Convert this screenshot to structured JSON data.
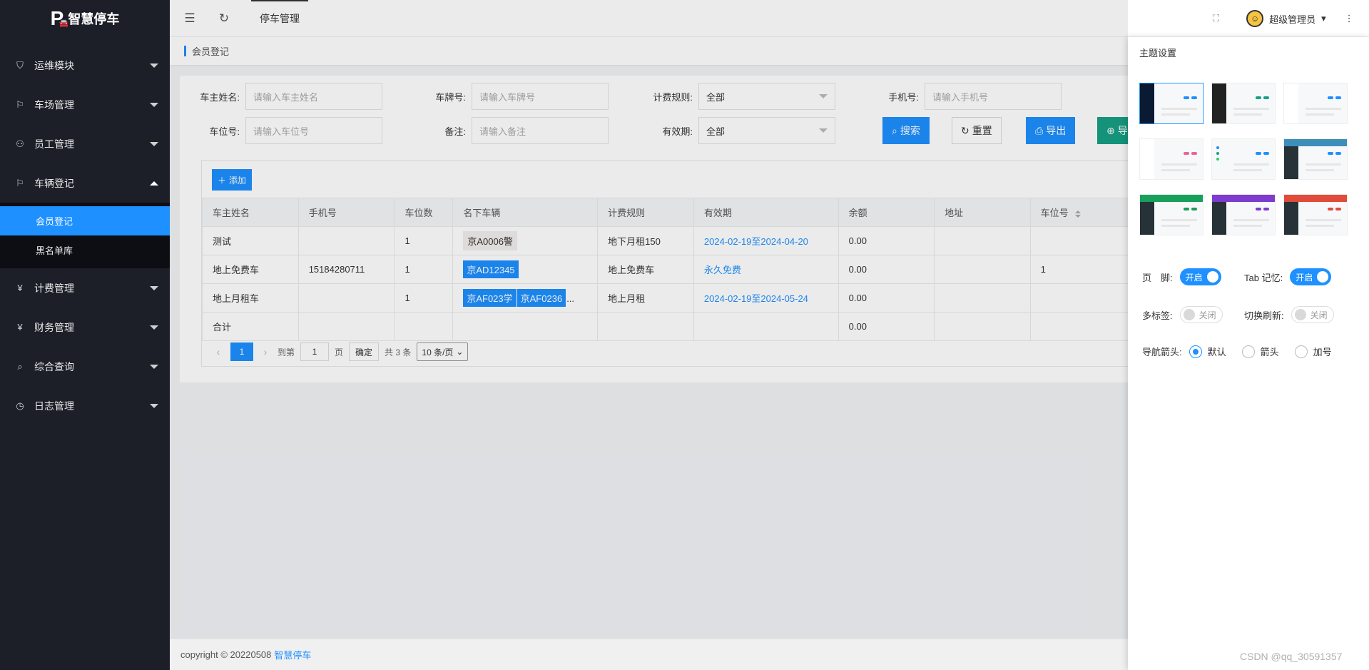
{
  "app": {
    "name": "智慧停车"
  },
  "sidebar": {
    "items": [
      {
        "label": "运维模块",
        "icon": "shield-icon"
      },
      {
        "label": "车场管理",
        "icon": "flag-icon"
      },
      {
        "label": "员工管理",
        "icon": "user-icon"
      },
      {
        "label": "车辆登记",
        "icon": "flag-icon"
      },
      {
        "label": "计费管理",
        "icon": "yen-icon"
      },
      {
        "label": "财务管理",
        "icon": "yen-icon"
      },
      {
        "label": "综合查询",
        "icon": "search-icon"
      },
      {
        "label": "日志管理",
        "icon": "clock-icon"
      }
    ],
    "submenu": [
      "会员登记",
      "黑名单库"
    ]
  },
  "header": {
    "tab": "停车管理",
    "user": "超级管理员"
  },
  "breadcrumb": "会员登记",
  "filters": {
    "owner_name": {
      "label": "车主姓名:",
      "placeholder": "请输入车主姓名"
    },
    "plate": {
      "label": "车牌号:",
      "placeholder": "请输入车牌号"
    },
    "billing_rule": {
      "label": "计费规则:",
      "value": "全部"
    },
    "phone": {
      "label": "手机号:",
      "placeholder": "请输入手机号"
    },
    "space_no": {
      "label": "车位号:",
      "placeholder": "请输入车位号"
    },
    "remark": {
      "label": "备注:",
      "placeholder": "请输入备注"
    },
    "validity": {
      "label": "有效期:",
      "value": "全部"
    }
  },
  "buttons": {
    "search": "搜索",
    "reset": "重置",
    "export": "导出",
    "import_partial": "导",
    "add": "添加"
  },
  "table": {
    "columns": [
      "车主姓名",
      "手机号",
      "车位数",
      "名下车辆",
      "计费规则",
      "有效期",
      "余额",
      "地址",
      "车位号"
    ],
    "rows": [
      {
        "name": "测试",
        "phone": "",
        "count": "1",
        "plates": [
          "京A0006警"
        ],
        "rule": "地下月租150",
        "validity": "2024-02-19至2024-04-20",
        "balance": "0.00",
        "address": "",
        "space": ""
      },
      {
        "name": "地上免费车",
        "phone": "15184280711",
        "count": "1",
        "plates": [
          "京AD12345"
        ],
        "rule": "地上免费车",
        "validity": "永久免费",
        "balance": "0.00",
        "address": "",
        "space": "1"
      },
      {
        "name": "地上月租车",
        "phone": "",
        "count": "1",
        "plates": [
          "京AF023学",
          "京AF0236"
        ],
        "plates_more": "...",
        "rule": "地上月租",
        "validity": "2024-02-19至2024-05-24",
        "balance": "0.00",
        "address": "",
        "space": ""
      }
    ],
    "total_row": {
      "label": "合计",
      "balance": "0.00"
    }
  },
  "pager": {
    "current": "1",
    "goto_label": "到第",
    "goto_value": "1",
    "page_unit": "页",
    "confirm": "确定",
    "total": "共 3 条",
    "page_size": "10 条/页"
  },
  "footer": {
    "copyright": "copyright © 20220508",
    "brand": "智慧停车"
  },
  "theme_drawer": {
    "title": "主题设置",
    "footer_label": "页　脚:",
    "footer_toggle": "开启",
    "tab_memory_label": "Tab 记忆:",
    "tab_memory_toggle": "开启",
    "multi_tab_label": "多标签:",
    "multi_tab_toggle": "关闭",
    "switch_refresh_label": "切换刷新:",
    "switch_refresh_toggle": "关闭",
    "nav_arrow_label": "导航箭头:",
    "nav_arrow_options": [
      "默认",
      "箭头",
      "加号"
    ]
  },
  "watermark": "CSDN @qq_30591357",
  "colors": {
    "accent": "#1e90ff",
    "sidebar": "#1c1f28",
    "green": "#16a085"
  }
}
